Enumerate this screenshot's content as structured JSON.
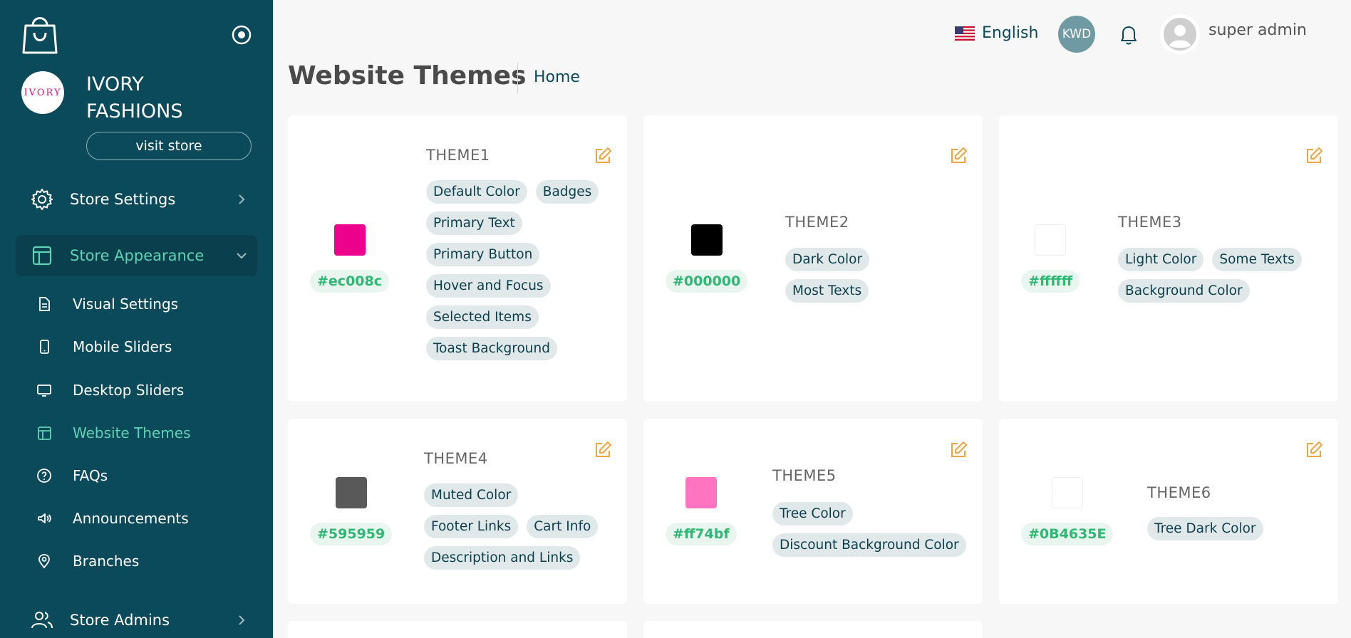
{
  "brand": {
    "name_line1": "IVORY",
    "name_line2": "FASHIONS",
    "avatar_text": "IVORY",
    "visit_store": "visit store"
  },
  "nav": {
    "store_settings": "Store Settings",
    "store_appearance": "Store Appearance",
    "store_admins": "Store Admins",
    "sub": {
      "visual_settings": "Visual Settings",
      "mobile_sliders": "Mobile Sliders",
      "desktop_sliders": "Desktop Sliders",
      "website_themes": "Website Themes",
      "faqs": "FAQs",
      "announcements": "Announcements",
      "branches": "Branches"
    }
  },
  "header": {
    "language": "English",
    "currency": "KWD",
    "user_name": "super admin"
  },
  "page": {
    "title": "Website Themes",
    "breadcrumb": "Home"
  },
  "themes": [
    {
      "name": "THEME1",
      "hex": "#ec008c",
      "tags": [
        "Default Color",
        "Badges",
        "Primary Text",
        "Primary Button",
        "Hover and Focus",
        "Selected Items",
        "Toast Background"
      ]
    },
    {
      "name": "THEME2",
      "hex": "#000000",
      "tags": [
        "Dark Color",
        "Most Texts"
      ]
    },
    {
      "name": "THEME3",
      "hex": "#ffffff",
      "tags": [
        "Light Color",
        "Some Texts",
        "Background Color"
      ]
    },
    {
      "name": "THEME4",
      "hex": "#595959",
      "tags": [
        "Muted Color",
        "Footer Links",
        "Cart Info",
        "Description and Links"
      ]
    },
    {
      "name": "THEME5",
      "hex": "#ff74bf",
      "tags": [
        "Tree Color",
        "Discount Background Color"
      ]
    },
    {
      "name": "THEME6",
      "hex": "#0B4635E",
      "tags": [
        "Tree Dark Color"
      ]
    }
  ],
  "colors": {
    "sidebar": "#0b4a5a",
    "accent": "#5fd3b4",
    "edit_icon": "#f0a640",
    "hex_text": "#2fb874"
  }
}
